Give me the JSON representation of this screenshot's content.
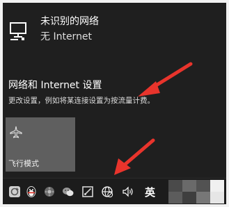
{
  "network": {
    "name": "未识别的网络",
    "status": "无 Internet",
    "icon": "monitor-network-icon"
  },
  "settings": {
    "link_text": "网络和 Internet 设置",
    "description": "更改设置，例如将某连接设置为按流量计费。"
  },
  "quick_actions": [
    {
      "label": "飞行模式",
      "icon": "airplane-icon"
    }
  ],
  "taskbar": {
    "tray_icons": [
      "sync-icon",
      "qq-penguin-icon",
      "color-ball-icon",
      "wechat-icon",
      "screenshot-icon",
      "network-globe-icon",
      "volume-icon"
    ],
    "ime": "英"
  },
  "colors": {
    "flyout_bg": "#1f1f1f",
    "tile_bg": "#5f5f5f",
    "arrow": "#e8342c"
  }
}
